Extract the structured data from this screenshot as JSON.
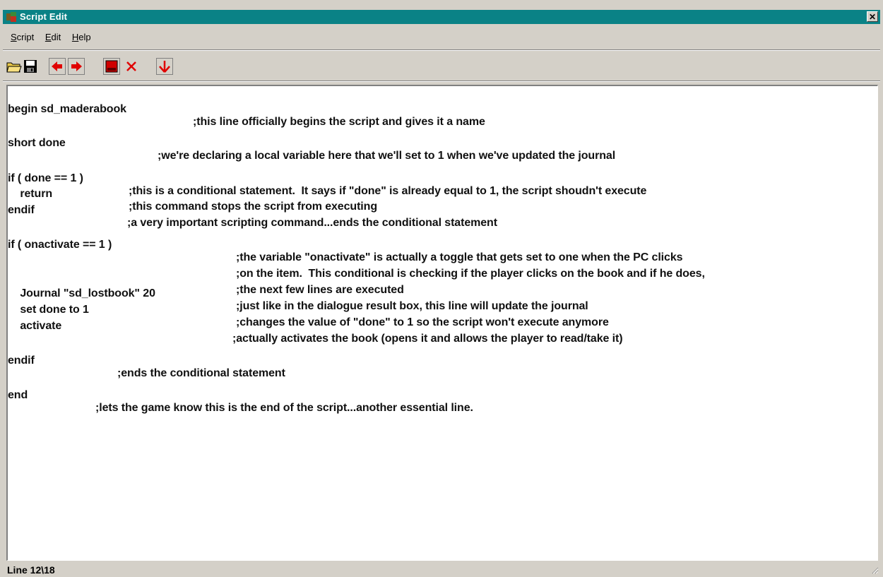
{
  "window": {
    "title": "Script Edit"
  },
  "menu": {
    "items": [
      {
        "label": "Script"
      },
      {
        "label": "Edit"
      },
      {
        "label": "Help"
      }
    ]
  },
  "toolbar": {
    "buttons": [
      {
        "icon": "open-folder-icon"
      },
      {
        "icon": "save-disk-icon"
      },
      {
        "icon": "arrow-left-icon"
      },
      {
        "icon": "arrow-right-icon"
      },
      {
        "icon": "record-icon"
      },
      {
        "icon": "delete-x-icon"
      },
      {
        "icon": "arrow-down-icon"
      }
    ]
  },
  "editor": {
    "lines": [
      {
        "cmd": "begin sd_maderabook",
        "comment": ";this line officially begins the script and gives it a name"
      },
      {
        "cmd": "short done",
        "comment": ";we're declaring a local variable here that we'll set to 1 when we've updated the journal"
      },
      {
        "cmd": "if ( done == 1 )",
        "comment": ";this is a conditional statement.  It says if \"done\" is already equal to 1, the script shoudn't execute"
      },
      {
        "cmd": "    return",
        "comment": ";this command stops the script from executing"
      },
      {
        "cmd": "endif",
        "comment": ";a very important scripting command...ends the conditional statement"
      },
      {
        "cmd": "if ( onactivate == 1 )",
        "comment": ";the variable \"onactivate\" is actually a toggle that gets set to one when the PC clicks"
      },
      {
        "cmd": "",
        "comment": ";on the item.  This conditional is checking if the player clicks on the book and if he does,"
      },
      {
        "cmd": "",
        "comment": ";the next few lines are executed"
      },
      {
        "cmd": "    Journal \"sd_lostbook\" 20",
        "comment": ";just like in the dialogue result box, this line will update the journal"
      },
      {
        "cmd": "    set done to 1",
        "comment": ";changes the value of \"done\" to 1 so the script won't execute anymore"
      },
      {
        "cmd": "    activate",
        "comment": ";actually activates the book (opens it and allows the player to read/take it)"
      },
      {
        "cmd": "endif",
        "comment": ";ends the conditional statement"
      },
      {
        "cmd": "end",
        "comment": ";lets the game know this is the end of the script...another essential line."
      }
    ]
  },
  "status": {
    "text": "Line 12\\18"
  },
  "colors": {
    "titlebar": "#0a8286",
    "accent_red": "#e00000",
    "face": "#d4d0c8"
  }
}
